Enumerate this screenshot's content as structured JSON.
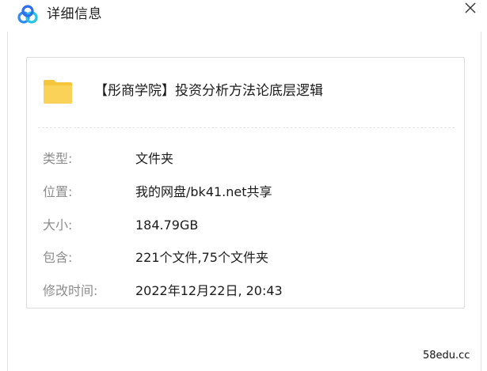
{
  "window": {
    "title": "详细信息",
    "icons": {
      "app_logo": "baidu-netdisk-logo-icon",
      "close": "close-icon",
      "folder": "folder-icon"
    }
  },
  "item": {
    "name": "【彤商学院】投资分析方法论底层逻辑"
  },
  "details": [
    {
      "label": "类型:",
      "value": "文件夹"
    },
    {
      "label": "位置:",
      "value": "我的网盘/bk41.net共享"
    },
    {
      "label": "大小:",
      "value": "184.79GB"
    },
    {
      "label": "包含:",
      "value": "221个文件,75个文件夹"
    },
    {
      "label": "修改时间:",
      "value": "2022年12月22日, 20:43"
    }
  ],
  "watermark": "58edu.cc",
  "colors": {
    "folder": "#f9d257",
    "logo_blue": "#2e8bf0",
    "logo_cyan": "#28c3e6"
  }
}
